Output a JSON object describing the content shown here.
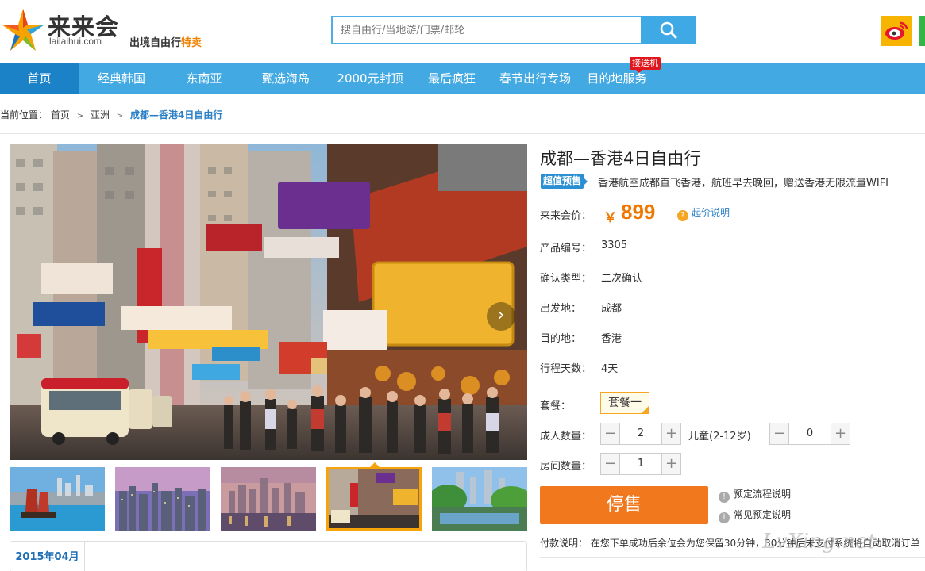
{
  "header": {
    "logo_cn": "来来会",
    "logo_en": "lailaihui.com",
    "slogan_main": "出境自由行",
    "slogan_highlight": "特卖",
    "search_placeholder": "搜自由行/当地游/门票/邮轮"
  },
  "icons": {
    "search": "search-icon",
    "weibo": "weibo-icon",
    "wechat": "wechat-icon",
    "next": "chevron-right-icon",
    "question": "question-icon",
    "info": "info-icon"
  },
  "nav": {
    "items": [
      {
        "label": "首页",
        "active": true
      },
      {
        "label": "经典韩国"
      },
      {
        "label": "东南亚"
      },
      {
        "label": "甄选海岛"
      },
      {
        "label": "2000元封顶"
      },
      {
        "label": "最后疯狂"
      },
      {
        "label": "春节出行专场"
      },
      {
        "label": "目的地服务"
      }
    ],
    "badge": "接送机"
  },
  "breadcrumb": {
    "prefix": "当前位置：",
    "items": [
      "首页",
      "亚洲"
    ],
    "separator": ">",
    "current": "成都—香港4日自由行"
  },
  "calendar": {
    "month": "2015年04月"
  },
  "product": {
    "title": "成都—香港4日自由行",
    "promo_tag": "超值预售",
    "promo_text": "香港航空成都直飞香港，航班早去晚回，赠送香港无限流量WIFI",
    "price_label": "来来会价：",
    "price_symbol": "￥",
    "price": "899",
    "price_help": "起价说明",
    "fields": [
      {
        "label": "产品编号：",
        "value": "3305"
      },
      {
        "label": "确认类型：",
        "value": "二次确认"
      },
      {
        "label": "出发地：",
        "value": "成都"
      },
      {
        "label": "目的地：",
        "value": "香港"
      },
      {
        "label": "行程天数：",
        "value": "4天"
      }
    ],
    "package_label": "套餐：",
    "package_value": "套餐一",
    "adult_label": "成人数量：",
    "adult_count": "2",
    "child_label": "儿童(2-12岁)",
    "child_count": "0",
    "room_label": "房间数量：",
    "room_count": "1",
    "minus": "−",
    "plus": "+",
    "stop_button": "停售",
    "help_links": [
      "预定流程说明",
      "常见预定说明"
    ],
    "pay_note_label": "付款说明：",
    "pay_note": "在您下单成功后余位会为您保留30分钟，30分钟后未支付系统将自动取消订单"
  },
  "watermark": "LvXing.net",
  "colors": {
    "nav_bg": "#42a9e2",
    "nav_active": "#1b82c8",
    "price": "#f07800",
    "stop_button": "#f2781d",
    "link": "#2a7fc7"
  }
}
